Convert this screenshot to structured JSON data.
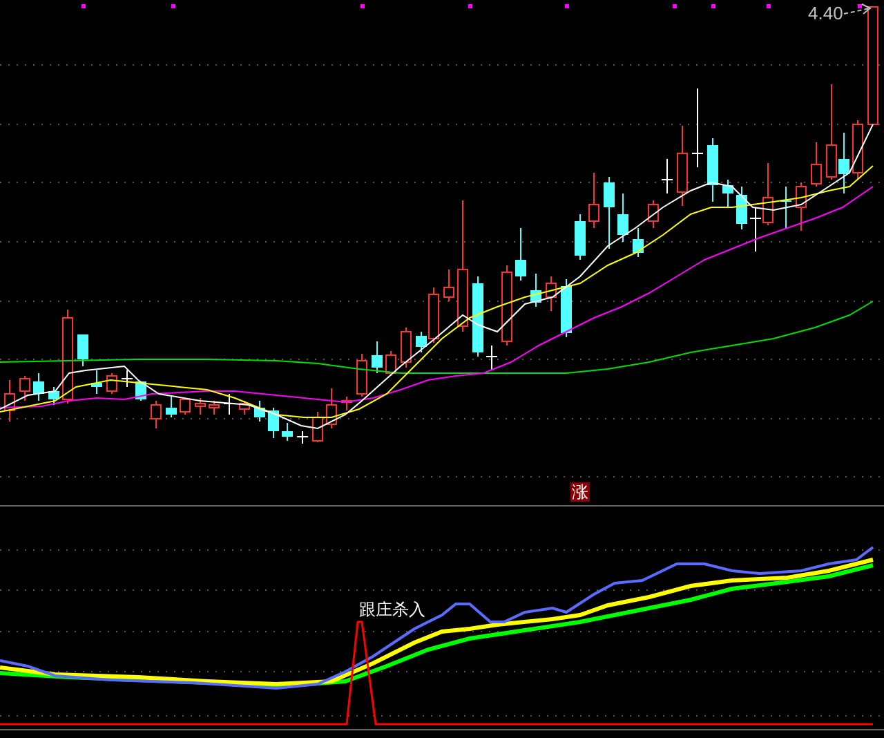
{
  "price_chart": {
    "price_label": "4.40"
  },
  "indicator_panel": {
    "signal_badge": "涨",
    "signal_label": "跟庄杀入"
  }
}
